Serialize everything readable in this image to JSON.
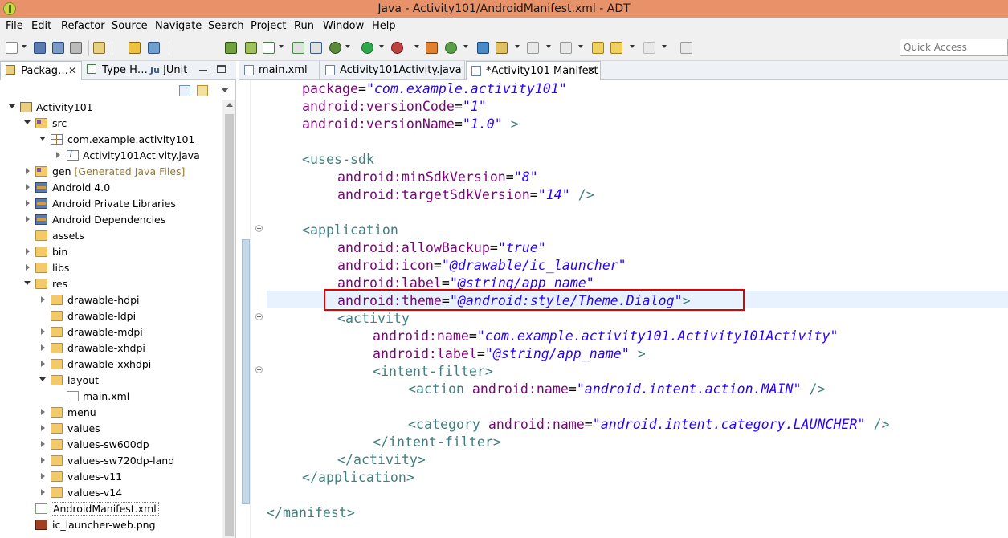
{
  "window": {
    "title": "Java - Activity101/AndroidManifest.xml - ADT"
  },
  "menubar": {
    "items": [
      "File",
      "Edit",
      "Refactor",
      "Source",
      "Navigate",
      "Search",
      "Project",
      "Run",
      "Window",
      "Help"
    ]
  },
  "toolbar": {
    "quick_access_placeholder": "Quick Access"
  },
  "left_panel": {
    "tabs": [
      {
        "label": "Packag…",
        "icon": "package-explorer-icon"
      },
      {
        "label": "Type H…",
        "icon": "type-hierarchy-icon"
      },
      {
        "label": "JUnit",
        "icon": "junit-icon"
      }
    ],
    "tree": [
      {
        "label": "Activity101",
        "icon": "project-icon"
      },
      {
        "label": "src",
        "icon": "source-folder-icon"
      },
      {
        "label": "com.example.activity101",
        "icon": "package-icon"
      },
      {
        "label": "Activity101Activity.java",
        "icon": "java-file-icon"
      },
      {
        "label": "gen",
        "decoration": "[Generated Java Files]",
        "icon": "source-folder-icon"
      },
      {
        "label": "Android 4.0",
        "icon": "library-icon"
      },
      {
        "label": "Android Private Libraries",
        "icon": "library-icon"
      },
      {
        "label": "Android Dependencies",
        "icon": "library-icon"
      },
      {
        "label": "assets",
        "icon": "folder-icon"
      },
      {
        "label": "bin",
        "icon": "folder-icon"
      },
      {
        "label": "libs",
        "icon": "folder-icon"
      },
      {
        "label": "res",
        "icon": "folder-icon"
      },
      {
        "label": "drawable-hdpi",
        "icon": "folder-icon"
      },
      {
        "label": "drawable-ldpi",
        "icon": "folder-icon"
      },
      {
        "label": "drawable-mdpi",
        "icon": "folder-icon"
      },
      {
        "label": "drawable-xhdpi",
        "icon": "folder-icon"
      },
      {
        "label": "drawable-xxhdpi",
        "icon": "folder-icon"
      },
      {
        "label": "layout",
        "icon": "folder-icon"
      },
      {
        "label": "main.xml",
        "icon": "xml-file-icon"
      },
      {
        "label": "menu",
        "icon": "folder-icon"
      },
      {
        "label": "values",
        "icon": "folder-icon"
      },
      {
        "label": "values-sw600dp",
        "icon": "folder-icon"
      },
      {
        "label": "values-sw720dp-land",
        "icon": "folder-icon"
      },
      {
        "label": "values-v11",
        "icon": "folder-icon"
      },
      {
        "label": "values-v14",
        "icon": "folder-icon"
      },
      {
        "label": "AndroidManifest.xml",
        "icon": "xml-file-icon"
      },
      {
        "label": "ic_launcher-web.png",
        "icon": "png-file-icon"
      }
    ]
  },
  "editor": {
    "tabs": [
      {
        "label": "main.xml",
        "active": false
      },
      {
        "label": "Activity101Activity.java",
        "active": false
      },
      {
        "label": "*Activity101 Manifest",
        "active": true
      }
    ],
    "code": {
      "l0": {
        "attr": "package",
        "eq": "=",
        "val": "\"com.example.activity101\""
      },
      "l1": {
        "attr": "android:versionCode",
        "eq": "=",
        "val": "\"1\""
      },
      "l2": {
        "attr": "android:versionName",
        "eq": "=",
        "val": "\"1.0\"",
        "tail": " >"
      },
      "l3": {
        "tag": "<uses-sdk"
      },
      "l4": {
        "attr": "android:minSdkVersion",
        "eq": "=",
        "val": "\"8\""
      },
      "l5": {
        "attr": "android:targetSdkVersion",
        "eq": "=",
        "val": "\"14\"",
        "tail": " />"
      },
      "l6": {
        "tag": "<application"
      },
      "l7": {
        "attr": "android:allowBackup",
        "eq": "=",
        "val": "\"true\""
      },
      "l8": {
        "attr": "android:icon",
        "eq": "=",
        "val": "\"@drawable/ic_launcher\""
      },
      "l9": {
        "attr": "android:label",
        "eq": "=",
        "val": "\"@string/app_name\""
      },
      "l10": {
        "attr": "android:theme",
        "eq": "=",
        "val": "\"@android:style/Theme.Dialog\"",
        "tail": ">"
      },
      "l11": {
        "tag": "<activity"
      },
      "l12": {
        "attr": "android:name",
        "eq": "=",
        "val": "\"com.example.activity101.Activity101Activity\""
      },
      "l13": {
        "attr": "android:label",
        "eq": "=",
        "val": "\"@string/app_name\"",
        "tail": " >"
      },
      "l14": {
        "tag": "<intent-filter>"
      },
      "l15": {
        "tag": "<action",
        "attr": " android:name",
        "eq": "=",
        "val": "\"android.intent.action.MAIN\"",
        "tail": " />"
      },
      "l16": {
        "tag": "<category",
        "attr": " android:name",
        "eq": "=",
        "val": "\"android.intent.category.LAUNCHER\"",
        "tail": " />"
      },
      "l17": {
        "tag": "</intent-filter>"
      },
      "l18": {
        "tag": "</activity>"
      },
      "l19": {
        "tag": "</application>"
      },
      "l20": {
        "tag": "</manifest>"
      }
    }
  },
  "colors": {
    "titlebar": "#e8926a",
    "xml_tag": "#3f7f7f",
    "xml_attr": "#7f007f",
    "xml_value": "#2a00ff",
    "annotation_box": "#e00000",
    "current_line": "#e8f2fe"
  }
}
